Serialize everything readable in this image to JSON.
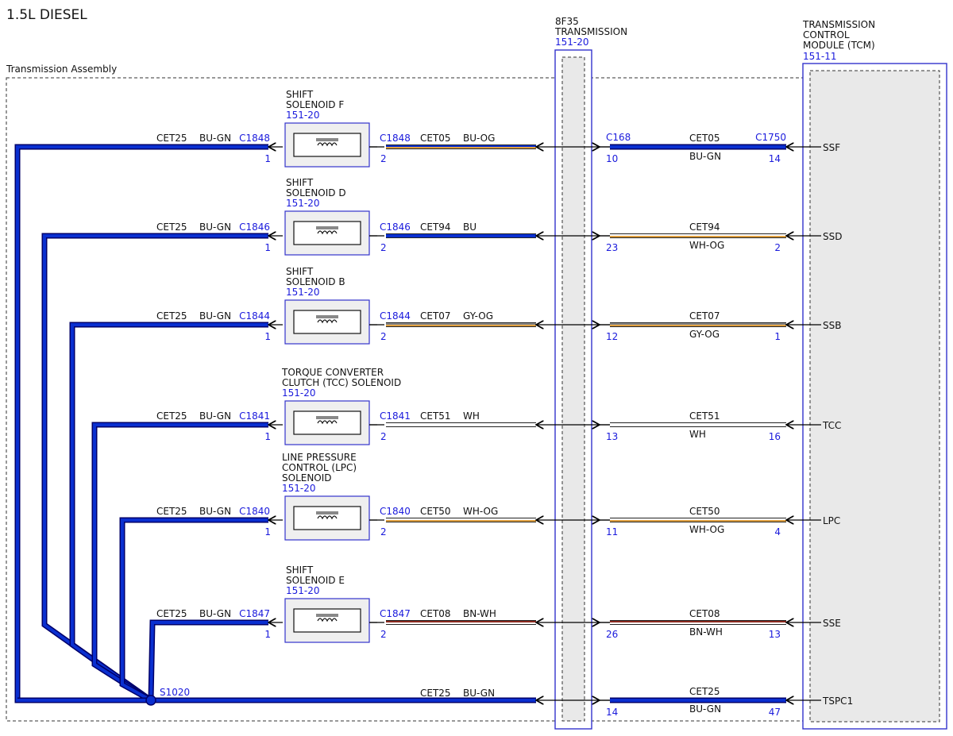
{
  "title": "1.5L DIESEL",
  "assembly_label": "Transmission Assembly",
  "colors": {
    "wire_blue": "#0a2fd0",
    "wire_blue_outline": "#00006a",
    "ref_text": "#1a1adc",
    "box_fill": "#efefef"
  },
  "transmission": {
    "name_line1": "8F35",
    "name_line2": "TRANSMISSION",
    "ref": "151-20"
  },
  "tcm": {
    "name_line1": "TRANSMISSION",
    "name_line2": "CONTROL",
    "name_line3": "MODULE (TCM)",
    "ref": "151-11"
  },
  "splice": "S1020",
  "solenoids": [
    {
      "name_lines": [
        "SHIFT",
        "SOLENOID F"
      ],
      "ref": "151-20",
      "left_circuit": "CET25",
      "left_color": "BU-GN",
      "left_connector": "C1848",
      "left_pin": "1",
      "right_connector": "C1848",
      "right_pin": "2",
      "mid_circuit": "CET05",
      "mid_color": "BU-OG",
      "trans_in_connector": "C168",
      "trans_pin": "10",
      "tcm_circuit": "CET05",
      "tcm_color": "BU-GN",
      "tcm_connector": "C1750",
      "tcm_pin": "14",
      "signal": "SSF"
    },
    {
      "name_lines": [
        "SHIFT",
        "SOLENOID D"
      ],
      "ref": "151-20",
      "left_circuit": "CET25",
      "left_color": "BU-GN",
      "left_connector": "C1846",
      "left_pin": "1",
      "right_connector": "C1846",
      "right_pin": "2",
      "mid_circuit": "CET94",
      "mid_color": "BU",
      "trans_pin": "23",
      "tcm_circuit": "CET94",
      "tcm_color": "WH-OG",
      "tcm_pin": "2",
      "signal": "SSD"
    },
    {
      "name_lines": [
        "SHIFT",
        "SOLENOID B"
      ],
      "ref": "151-20",
      "left_circuit": "CET25",
      "left_color": "BU-GN",
      "left_connector": "C1844",
      "left_pin": "1",
      "right_connector": "C1844",
      "right_pin": "2",
      "mid_circuit": "CET07",
      "mid_color": "GY-OG",
      "trans_pin": "12",
      "tcm_circuit": "CET07",
      "tcm_color": "GY-OG",
      "tcm_pin": "1",
      "signal": "SSB"
    },
    {
      "name_lines": [
        "TORQUE CONVERTER",
        "CLUTCH (TCC) SOLENOID"
      ],
      "ref": "151-20",
      "left_circuit": "CET25",
      "left_color": "BU-GN",
      "left_connector": "C1841",
      "left_pin": "1",
      "right_connector": "C1841",
      "right_pin": "2",
      "mid_circuit": "CET51",
      "mid_color": "WH",
      "trans_pin": "13",
      "tcm_circuit": "CET51",
      "tcm_color": "WH",
      "tcm_pin": "16",
      "signal": "TCC"
    },
    {
      "name_lines": [
        "LINE PRESSURE",
        "CONTROL (LPC)",
        "SOLENOID"
      ],
      "ref": "151-20",
      "left_circuit": "CET25",
      "left_color": "BU-GN",
      "left_connector": "C1840",
      "left_pin": "1",
      "right_connector": "C1840",
      "right_pin": "2",
      "mid_circuit": "CET50",
      "mid_color": "WH-OG",
      "trans_pin": "11",
      "tcm_circuit": "CET50",
      "tcm_color": "WH-OG",
      "tcm_pin": "4",
      "signal": "LPC"
    },
    {
      "name_lines": [
        "SHIFT",
        "SOLENOID E"
      ],
      "ref": "151-20",
      "left_circuit": "CET25",
      "left_color": "BU-GN",
      "left_connector": "C1847",
      "left_pin": "1",
      "right_connector": "C1847",
      "right_pin": "2",
      "mid_circuit": "CET08",
      "mid_color": "BN-WH",
      "trans_pin": "26",
      "tcm_circuit": "CET08",
      "tcm_color": "BN-WH",
      "tcm_pin": "13",
      "signal": "SSE"
    }
  ],
  "tspc": {
    "mid_circuit": "CET25",
    "mid_color": "BU-GN",
    "trans_pin": "14",
    "tcm_circuit": "CET25",
    "tcm_color": "BU-GN",
    "tcm_pin": "47",
    "signal": "TSPC1"
  }
}
